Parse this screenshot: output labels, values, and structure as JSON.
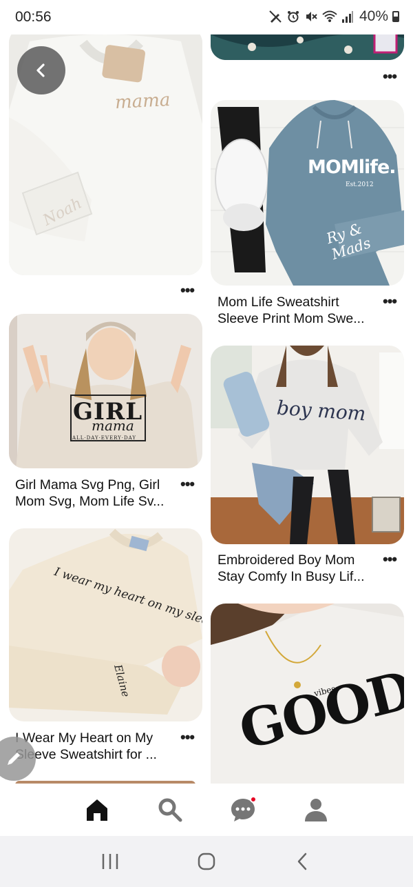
{
  "status_bar": {
    "time": "00:56",
    "battery": "40%"
  },
  "pins": [
    {
      "id": "pin-mama-sweatshirt",
      "title": "",
      "image_text": [
        "mama",
        "Noah"
      ]
    },
    {
      "id": "pin-top-right-partial",
      "title": ""
    },
    {
      "id": "pin-mom-life",
      "title": "Mom Life Sweatshirt Sleeve Print Mom Swe...",
      "image_text": [
        "MOMlife.",
        "Est.2012",
        "Ry & Mads"
      ]
    },
    {
      "id": "pin-girl-mama",
      "title": "Girl Mama Svg Png, Girl Mom Svg, Mom Life Sv...",
      "image_text": [
        "GIRL",
        "mama",
        "ALL·DAY·EVERY·DAY"
      ]
    },
    {
      "id": "pin-boy-mom",
      "title": "Embroidered Boy Mom Stay Comfy In Busy Lif...",
      "image_text": [
        "boy mom"
      ]
    },
    {
      "id": "pin-heart-sleeve",
      "title": "I Wear My Heart on My Sleeve Sweatshirt for ...",
      "image_text": [
        "I wear my heart on my sleeve",
        "Elaine"
      ]
    },
    {
      "id": "pin-good-vibes",
      "title": "",
      "image_text": [
        "GOOD",
        "vibes"
      ]
    }
  ],
  "more_label": "•••",
  "bottom_nav": {
    "items": [
      {
        "name": "home",
        "icon": "home-icon"
      },
      {
        "name": "search",
        "icon": "search-icon"
      },
      {
        "name": "messages",
        "icon": "chat-icon"
      },
      {
        "name": "profile",
        "icon": "profile-icon"
      }
    ]
  },
  "colors": {
    "accent": "#e60023",
    "nav_bg": "#f2f2f4"
  }
}
